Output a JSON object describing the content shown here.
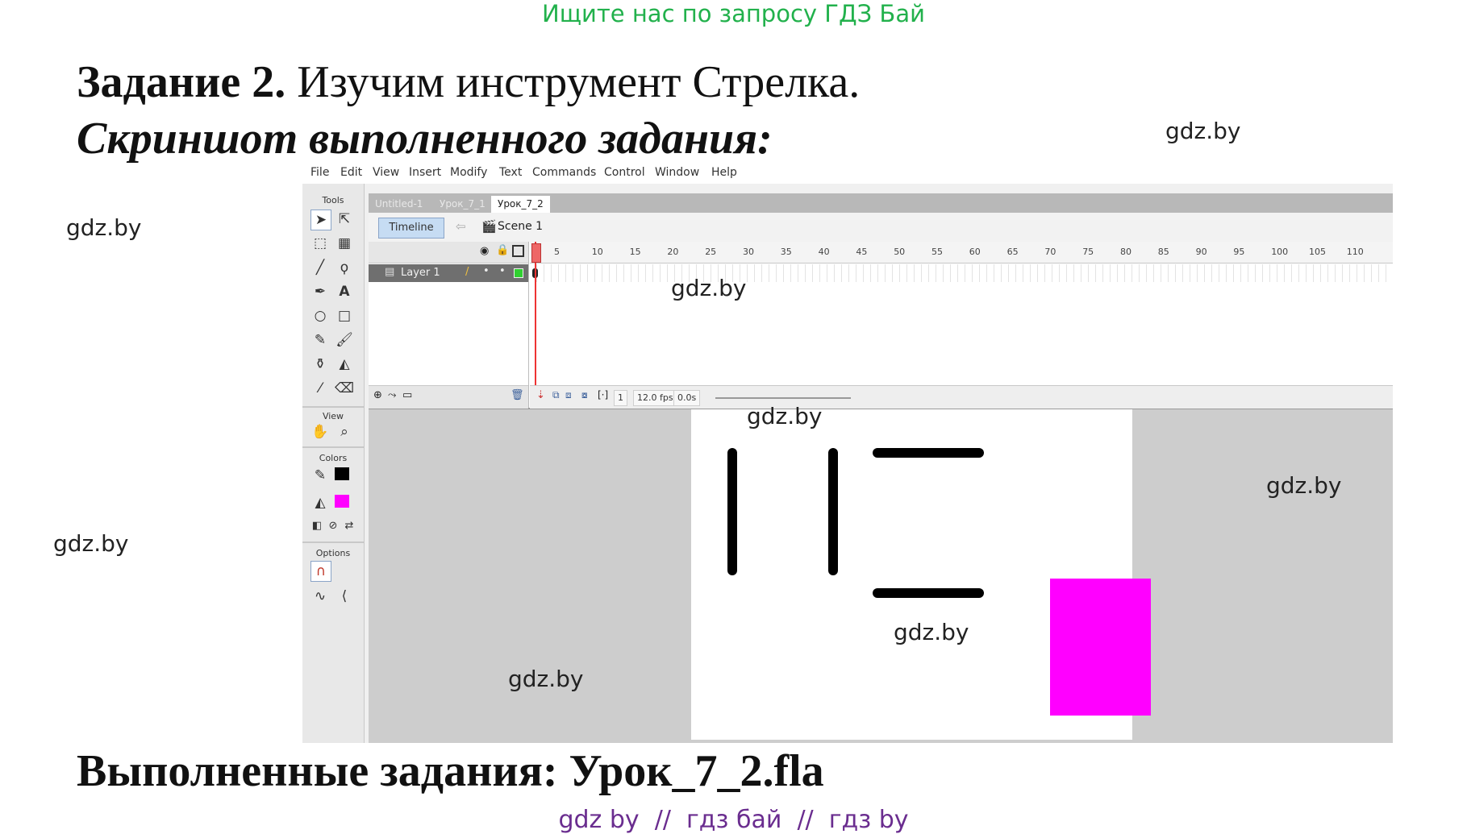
{
  "banner": "Ищите нас по запросу ГДЗ Бай",
  "task": {
    "label": "Задание 2.",
    "text": "Изучим инструмент Стрелка.",
    "subtitle": "Скриншот выполненного задания:"
  },
  "watermarks": {
    "w1": "gdz.by",
    "w2": "gdz.by",
    "w3": "gdz.by",
    "w4": "gdz.by",
    "w5": "gdz.by",
    "w6": "gdz.by",
    "w7": "gdz.by",
    "w8": "gdz.by"
  },
  "done_text": "Выполненные задания: Урок_7_2.fla",
  "bottom_watermark": "gdz by  //  гдз бай  //  гдз by",
  "flash": {
    "menu": [
      "File",
      "Edit",
      "View",
      "Insert",
      "Modify",
      "Text",
      "Commands",
      "Control",
      "Window",
      "Help"
    ],
    "tools_label": "Tools",
    "view_label": "View",
    "colors_label": "Colors",
    "options_label": "Options",
    "tabs": [
      "Untitled-1",
      "Урок_7_1",
      "Урок_7_2"
    ],
    "timeline_button": "Timeline",
    "scene": "Scene 1",
    "layer_name": "Layer 1",
    "ruler": [
      "5",
      "10",
      "15",
      "20",
      "25",
      "30",
      "35",
      "40",
      "45",
      "50",
      "55",
      "60",
      "65",
      "70",
      "75",
      "80",
      "85",
      "90",
      "95",
      "100",
      "105",
      "110"
    ],
    "footer": {
      "frame": "1",
      "fps": "12.0 fps",
      "time": "0.0s"
    },
    "colors": {
      "stroke": "#000000",
      "fill": "#ff00ff"
    }
  }
}
